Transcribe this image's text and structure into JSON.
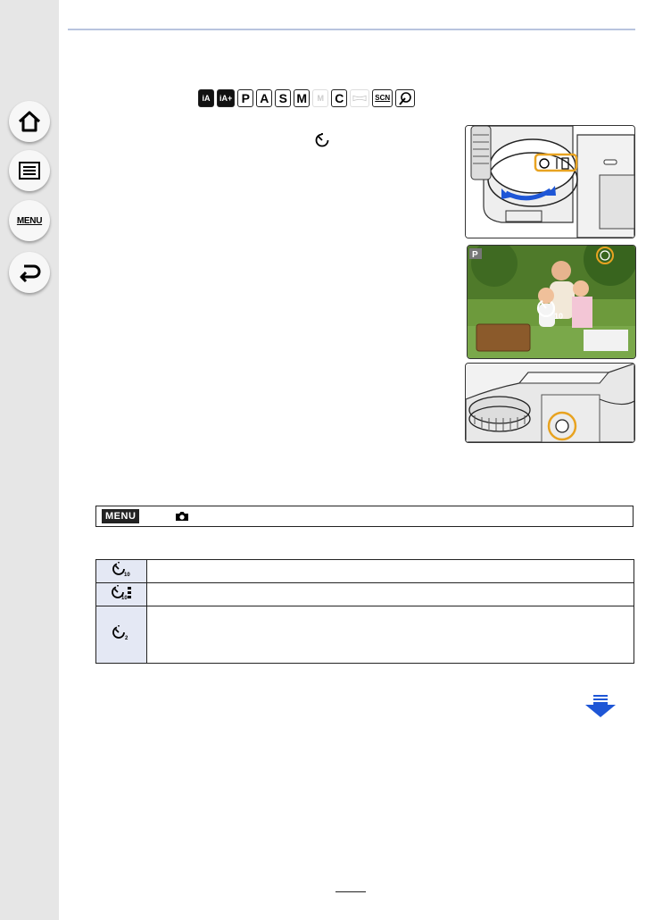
{
  "sidebar": {
    "items": [
      {
        "name": "home",
        "icon": "home-icon"
      },
      {
        "name": "contents",
        "icon": "list-icon"
      },
      {
        "name": "menu",
        "label": "MENU"
      },
      {
        "name": "back",
        "icon": "return-arrow-icon"
      }
    ]
  },
  "modes": {
    "available": [
      {
        "label": "iA",
        "style": "dark"
      },
      {
        "label": "iA+",
        "style": "dark"
      },
      {
        "label": "P"
      },
      {
        "label": "A"
      },
      {
        "label": "S"
      },
      {
        "label": "M"
      },
      {
        "label": "M",
        "style": "ghost",
        "note": "movie-mode"
      },
      {
        "label": "C"
      },
      {
        "label": "",
        "style": "ghost",
        "note": "panorama-mode"
      },
      {
        "label": "SCN",
        "style": "scn"
      },
      {
        "label": "",
        "note": "creative-control-mode"
      }
    ]
  },
  "figures": {
    "lcd_mode_label": "P",
    "lcd_timer_value": "10"
  },
  "menu_path": {
    "tag": "MENU",
    "icon": "camera-icon"
  },
  "table": {
    "rows": [
      {
        "icon": "self-timer-10s-icon",
        "sub": "10"
      },
      {
        "icon": "self-timer-10s-3-images-icon",
        "sub": "10"
      },
      {
        "icon": "self-timer-2s-icon",
        "sub": "2"
      }
    ]
  },
  "colors": {
    "sidebar_bg": "#e6e6e6",
    "rule": "#b8c4de",
    "icon_cell_bg": "#e4e8f4",
    "scroll_arrow": "#1e56d6",
    "highlight_ring": "#e8a321"
  }
}
